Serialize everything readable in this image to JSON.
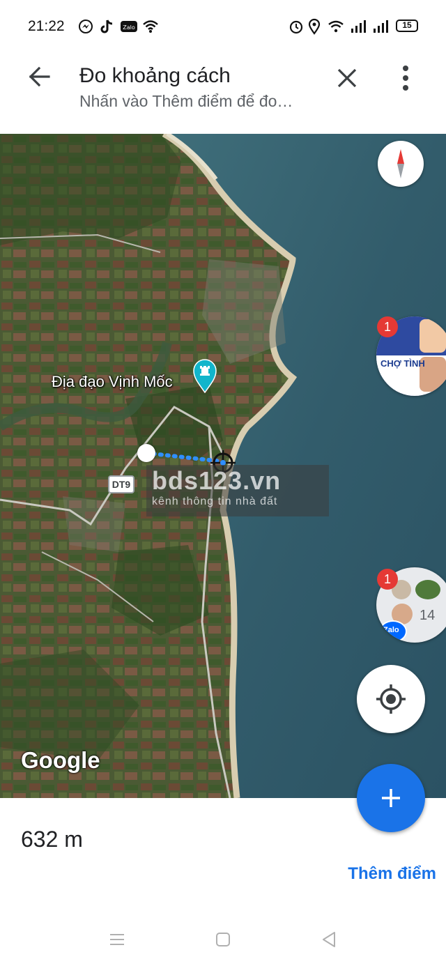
{
  "status_bar": {
    "time": "21:22",
    "battery": "15",
    "left_icons": [
      "messenger-icon",
      "tiktok-icon",
      "zalo-icon",
      "wifi-icon"
    ],
    "right_icons": [
      "alarm-icon",
      "location-icon",
      "wifi-signal-icon",
      "signal-1-icon",
      "signal-2-icon",
      "battery-icon"
    ]
  },
  "header": {
    "title": "Đo khoảng cách",
    "subtitle": "Nhấn vào Thêm điểm để đo…"
  },
  "map": {
    "poi_label": "Địa đạo Vịnh Mốc",
    "road_label": "DT9",
    "watermark_big": "bds123.vn",
    "watermark_small": "kênh thông tin nhà đất",
    "google_logo": "Google",
    "chat_heads": [
      {
        "badge": "1",
        "label": "CHỢ TÌNH"
      },
      {
        "badge": "1",
        "count": "14",
        "app": "Zalo"
      }
    ]
  },
  "bottom": {
    "distance": "632 m",
    "add_point_label": "Thêm điểm"
  },
  "colors": {
    "accent": "#1a73e8",
    "badge": "#e53935",
    "measure_line": "#2f8fff"
  }
}
